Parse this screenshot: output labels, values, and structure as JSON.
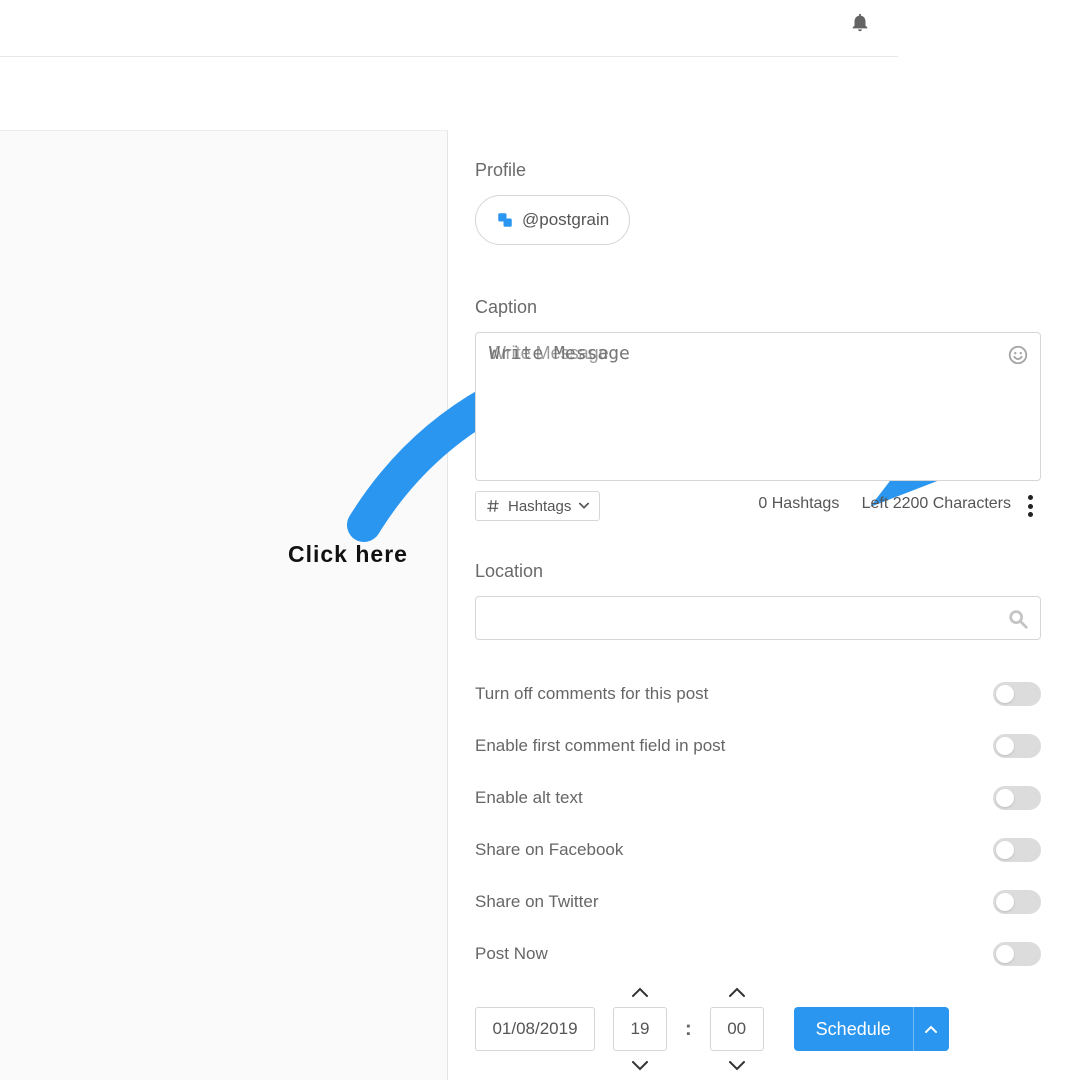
{
  "annotation": {
    "click_here": "Click here"
  },
  "profile": {
    "title": "Profile",
    "handle": "@postgrain"
  },
  "caption": {
    "title": "Caption",
    "placeholder": "Write Message",
    "value": "",
    "hashtags_button": "Hashtags",
    "hashtag_count_text": "0 Hashtags",
    "char_count_text": "Left 2200 Characters"
  },
  "location": {
    "title": "Location",
    "value": ""
  },
  "toggles": [
    {
      "label": "Turn off comments for this post",
      "on": false
    },
    {
      "label": "Enable first comment field in post",
      "on": false
    },
    {
      "label": "Enable alt text",
      "on": false
    },
    {
      "label": "Share on Facebook",
      "on": false
    },
    {
      "label": "Share on Twitter",
      "on": false
    },
    {
      "label": "Post Now",
      "on": false
    }
  ],
  "schedule": {
    "date": "01/08/2019",
    "hour": "19",
    "minute": "00",
    "button": "Schedule"
  },
  "colors": {
    "primary": "#2a96f0",
    "annotation_blue": "#2a96f0"
  }
}
